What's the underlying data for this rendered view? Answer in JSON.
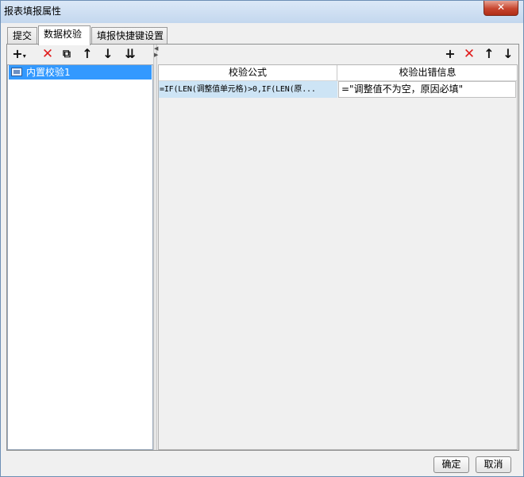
{
  "window": {
    "title": "报表填报属性",
    "close_label": "✕"
  },
  "tabs": [
    {
      "label": "提交"
    },
    {
      "label": "数据校验"
    },
    {
      "label": "填报快捷键设置"
    }
  ],
  "left_toolbar": {
    "icons": [
      "add-dropdown-icon",
      "delete-icon",
      "copy-icon",
      "move-up-icon",
      "move-down-icon",
      "sort-icon"
    ],
    "add_glyph": "+",
    "add_caret": "▾",
    "delete_glyph": "✕",
    "copy_glyph": "⧉",
    "up_glyph": "↑",
    "down_glyph": "↓",
    "sort_glyph": "⇊"
  },
  "list": {
    "items": [
      {
        "label": "内置校验1",
        "selected": true
      }
    ]
  },
  "right_toolbar": {
    "icons": [
      "add-icon",
      "delete-icon",
      "move-up-icon",
      "move-down-icon"
    ],
    "add_glyph": "+",
    "delete_glyph": "✕",
    "up_glyph": "↑",
    "down_glyph": "↓"
  },
  "grid": {
    "columns": [
      "校验公式",
      "校验出错信息"
    ],
    "rows": [
      {
        "formula": "=IF(LEN(调整值单元格)>0,IF(LEN(原...",
        "message": "=\"调整值不为空，原因必填\""
      }
    ]
  },
  "footer": {
    "ok_label": "确定",
    "cancel_label": "取消"
  },
  "colors": {
    "selection": "#3399ff",
    "delete_icon": "#e01c1c",
    "selected_cell": "#cde4f5"
  }
}
